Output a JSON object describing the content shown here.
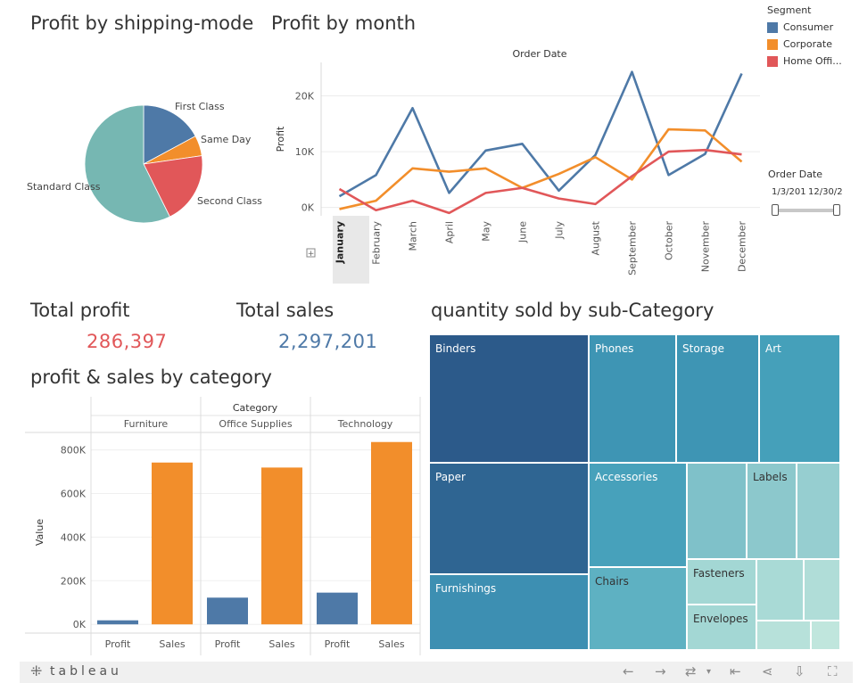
{
  "titles": {
    "shipping": "Profit by shipping-mode",
    "month": "Profit by month",
    "total_profit": "Total profit",
    "total_sales": "Total sales",
    "category": "profit & sales by category",
    "treemap": "quantity sold by sub-Category"
  },
  "kpis": {
    "profit_value": "286,397",
    "sales_value": "2,297,201",
    "profit_color": "#e15759",
    "sales_color": "#4e79a7"
  },
  "legend": {
    "title": "Segment",
    "items": [
      {
        "label": "Consumer",
        "color": "#4e79a7"
      },
      {
        "label": "Corporate",
        "color": "#f28e2b"
      },
      {
        "label": "Home Offi...",
        "color": "#e15759"
      }
    ]
  },
  "filter": {
    "title": "Order Date",
    "start": "1/3/201",
    "end": "12/30/2"
  },
  "chart_data": [
    {
      "type": "pie",
      "title": "Profit by shipping-mode",
      "slices": [
        {
          "label": "First Class",
          "value": 49,
          "color": "#4e79a7"
        },
        {
          "label": "Same Day",
          "value": 16,
          "color": "#f28e2b"
        },
        {
          "label": "Second Class",
          "value": 57,
          "color": "#e15759"
        },
        {
          "label": "Standard Class",
          "value": 164,
          "color": "#76b7b2"
        }
      ]
    },
    {
      "type": "line",
      "title": "Profit by month",
      "xlabel": "Order Date",
      "ylabel": "Profit",
      "categories": [
        "January",
        "February",
        "March",
        "April",
        "May",
        "June",
        "July",
        "August",
        "September",
        "October",
        "November",
        "December"
      ],
      "yticks": [
        "0K",
        "10K",
        "20K"
      ],
      "ylim": [
        -1500,
        26000
      ],
      "series": [
        {
          "name": "Consumer",
          "color": "#4e79a7",
          "values": [
            2000,
            5800,
            17800,
            2600,
            10200,
            11400,
            3000,
            9400,
            24300,
            5800,
            9600,
            24000
          ]
        },
        {
          "name": "Corporate",
          "color": "#f28e2b",
          "values": [
            -300,
            1200,
            7000,
            6400,
            7000,
            3500,
            6000,
            9000,
            5000,
            14000,
            13800,
            8200
          ]
        },
        {
          "name": "Home Office",
          "color": "#e15759",
          "values": [
            3300,
            -500,
            1200,
            -1000,
            2600,
            3500,
            1600,
            600,
            5600,
            10000,
            10300,
            9500
          ]
        }
      ]
    },
    {
      "type": "bar",
      "title": "profit & sales by category",
      "header": "Category",
      "ylabel": "Value",
      "yticks": [
        "0K",
        "200K",
        "400K",
        "600K",
        "800K"
      ],
      "ylim": [
        -40000,
        880000
      ],
      "groups": [
        {
          "name": "Furniture",
          "bars": [
            {
              "label": "Profit",
              "value": 18451,
              "color": "#4e79a7"
            },
            {
              "label": "Sales",
              "value": 741999,
              "color": "#f28e2b"
            }
          ]
        },
        {
          "name": "Office Supplies",
          "bars": [
            {
              "label": "Profit",
              "value": 122490,
              "color": "#4e79a7"
            },
            {
              "label": "Sales",
              "value": 719047,
              "color": "#f28e2b"
            }
          ]
        },
        {
          "name": "Technology",
          "bars": [
            {
              "label": "Profit",
              "value": 145455,
              "color": "#4e79a7"
            },
            {
              "label": "Sales",
              "value": 836154,
              "color": "#f28e2b"
            }
          ]
        }
      ]
    },
    {
      "type": "treemap",
      "title": "quantity sold by sub-Category",
      "cells": [
        {
          "label": "Binders",
          "color": "#2c5a8a"
        },
        {
          "label": "Phones",
          "color": "#3e95b4"
        },
        {
          "label": "Storage",
          "color": "#3e95b4"
        },
        {
          "label": "Art",
          "color": "#45a0ba"
        },
        {
          "label": "Paper",
          "color": "#2f6592"
        },
        {
          "label": "Accessories",
          "color": "#47a1bb"
        },
        {
          "label": "Labels",
          "color": "#8cc8cc"
        },
        {
          "label": "Furnishings",
          "color": "#3d8fb2"
        },
        {
          "label": "Chairs",
          "color": "#5eb1c2"
        },
        {
          "label": "Fasteners",
          "color": "#a3d7d4"
        },
        {
          "label": "Envelopes",
          "color": "#a3d7d4"
        },
        {
          "label": "",
          "color": "#7fc1c9"
        },
        {
          "label": "",
          "color": "#96ced0"
        },
        {
          "label": "",
          "color": "#a9dad6"
        },
        {
          "label": "",
          "color": "#b0ddd8"
        },
        {
          "label": "",
          "color": "#b7e1da"
        },
        {
          "label": "",
          "color": "#c0e6dd"
        }
      ]
    }
  ],
  "toolbar": {
    "logo": "tableau",
    "icons": [
      "undo-icon",
      "redo-icon",
      "revert-icon",
      "pause-icon",
      "share-icon",
      "download-icon",
      "fullscreen-icon"
    ]
  }
}
